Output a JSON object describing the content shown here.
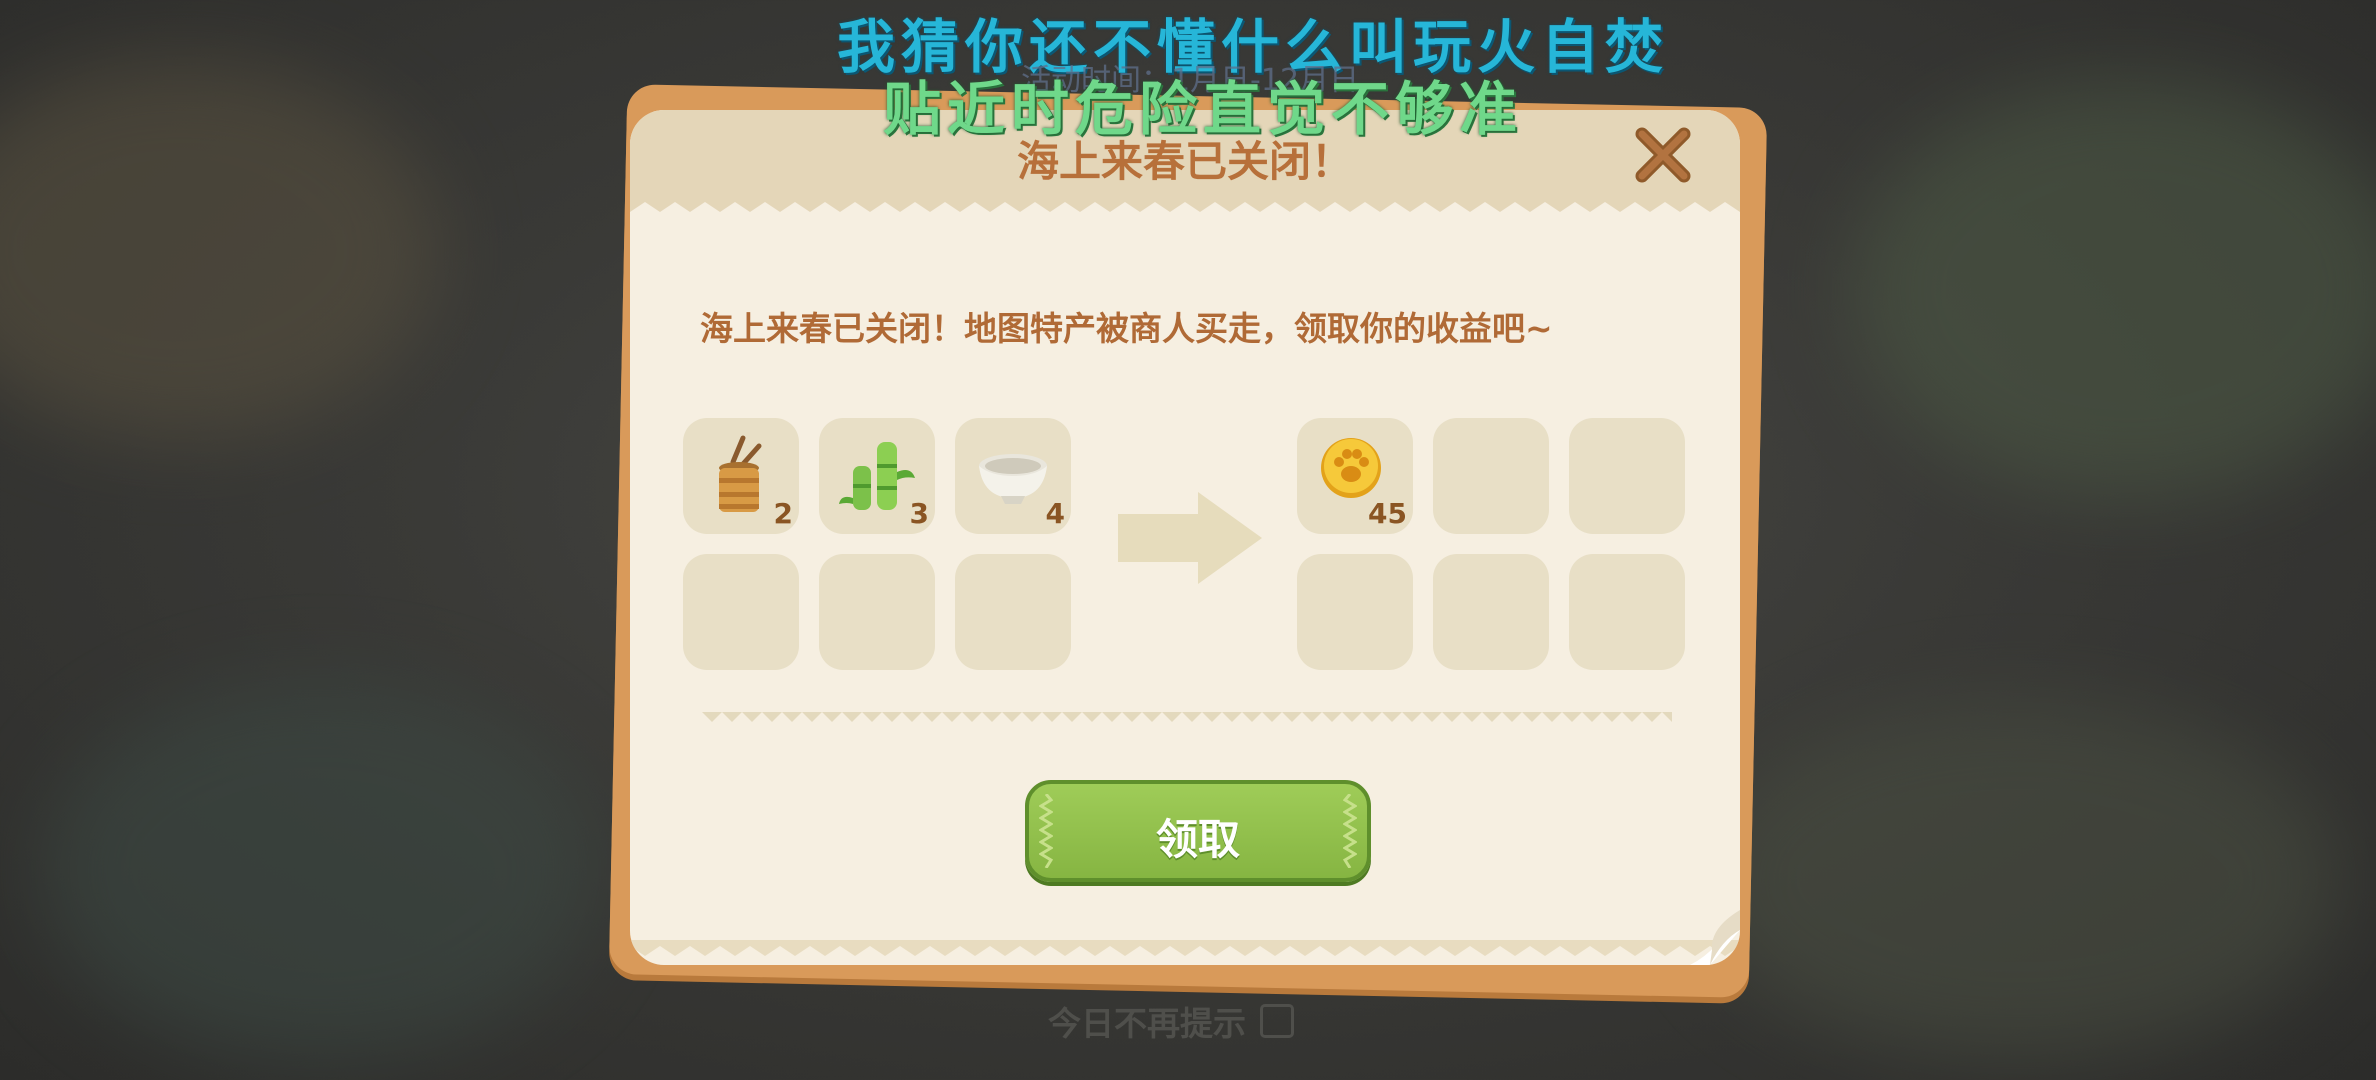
{
  "overlay": {
    "lyric_line1": "我猜你还不懂什么叫玩火自焚",
    "lyric_line2": "贴近时危险直觉不够准",
    "event_time": "活动时间：1月日-12月日"
  },
  "dialog": {
    "title": "海上来春已关闭！",
    "message": "海上来春已关闭！地图特产被商人买走，领取你的收益吧~",
    "close_icon": "close-icon",
    "input_items": [
      {
        "icon": "bamboo-basket-icon",
        "count": "2"
      },
      {
        "icon": "bamboo-shoot-icon",
        "count": "3"
      },
      {
        "icon": "white-bowl-icon",
        "count": "4"
      }
    ],
    "output_items": [
      {
        "icon": "paw-coin-icon",
        "count": "45"
      }
    ],
    "claim_label": "领取"
  },
  "footer": {
    "no_remind_label": "今日不再提示"
  },
  "colors": {
    "title": "#b7703a",
    "claim_button": "#8fbf4a",
    "card_bg": "#f6efe1",
    "card_border": "#d99a5a"
  }
}
